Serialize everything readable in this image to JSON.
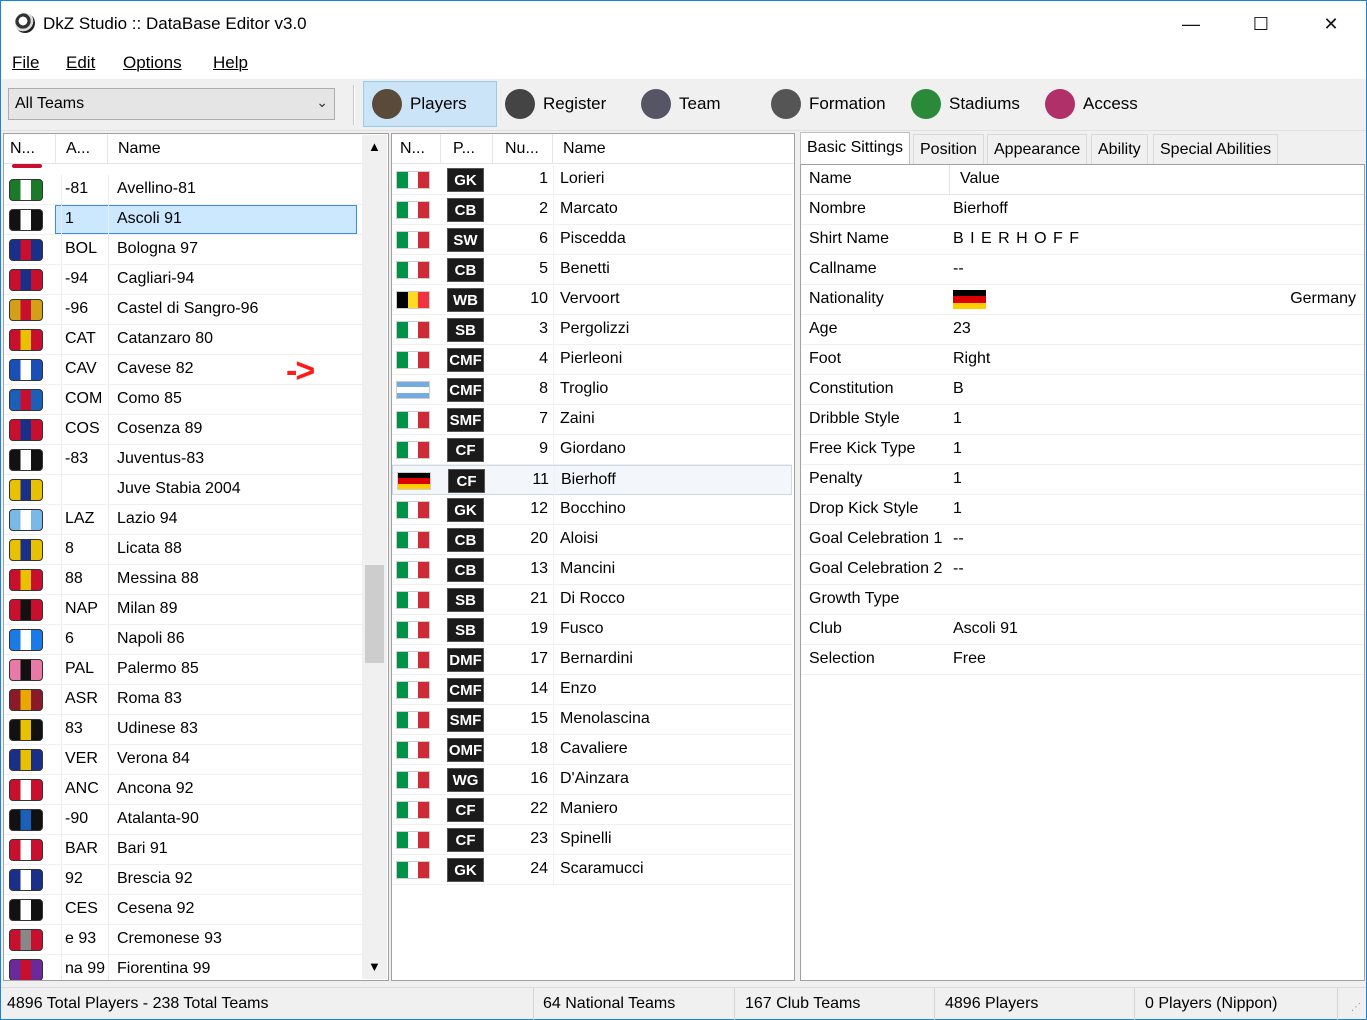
{
  "window": {
    "title": "DkZ Studio :: DataBase Editor v3.0",
    "minimize": "—",
    "maximize": "☐",
    "close": "✕"
  },
  "menu": [
    "File",
    "Edit",
    "Options",
    "Help"
  ],
  "toolbar": {
    "team_filter": "All Teams",
    "buttons": [
      {
        "label": "Players",
        "icon": "player-icon",
        "color": "#5a4a3a"
      },
      {
        "label": "Register",
        "icon": "register-icon",
        "color": "#444"
      },
      {
        "label": "Team",
        "icon": "team-icon",
        "color": "#556"
      },
      {
        "label": "Formation",
        "icon": "formation-icon",
        "color": "#555"
      },
      {
        "label": "Stadiums",
        "icon": "stadium-icon",
        "color": "#2a8a3a"
      },
      {
        "label": "Access",
        "icon": "access-icon",
        "color": "#b0306a"
      }
    ]
  },
  "teams_table": {
    "columns": [
      "N...",
      "A...",
      "Name"
    ],
    "selected_index": 1,
    "rows": [
      {
        "abbr": "-81",
        "name": "Avellino-81",
        "c1": "#1a7a2a",
        "c2": "#ffffff"
      },
      {
        "abbr": "1",
        "name": "Ascoli 91",
        "c1": "#111111",
        "c2": "#ffffff"
      },
      {
        "abbr": "BOL",
        "name": "Bologna 97",
        "c1": "#1a2f8a",
        "c2": "#c8102e"
      },
      {
        "abbr": "-94",
        "name": "Cagliari-94",
        "c1": "#c8102e",
        "c2": "#1a2f8a"
      },
      {
        "abbr": "-96",
        "name": "Castel di Sangro-96",
        "c1": "#d4a017",
        "c2": "#c8102e"
      },
      {
        "abbr": "CAT",
        "name": "Catanzaro 80",
        "c1": "#c8102e",
        "c2": "#e8c100"
      },
      {
        "abbr": "CAV",
        "name": "Cavese 82",
        "c1": "#1a4fb8",
        "c2": "#ffffff"
      },
      {
        "abbr": "COM",
        "name": "Como 85",
        "c1": "#1a5fb8",
        "c2": "#c8102e"
      },
      {
        "abbr": "COS",
        "name": "Cosenza 89",
        "c1": "#c8102e",
        "c2": "#1a2f8a"
      },
      {
        "abbr": "-83",
        "name": "Juventus-83",
        "c1": "#111111",
        "c2": "#ffffff"
      },
      {
        "abbr": "",
        "name": "Juve Stabia 2004",
        "c1": "#e8c100",
        "c2": "#1a2f8a"
      },
      {
        "abbr": "LAZ",
        "name": "Lazio 94",
        "c1": "#7ab8e8",
        "c2": "#ffffff"
      },
      {
        "abbr": "8",
        "name": "Licata 88",
        "c1": "#e8c100",
        "c2": "#1a2f8a"
      },
      {
        "abbr": "88",
        "name": "Messina 88",
        "c1": "#c8102e",
        "c2": "#e8c100"
      },
      {
        "abbr": "NAP",
        "name": "Milan 89",
        "c1": "#c8102e",
        "c2": "#111111"
      },
      {
        "abbr": "6",
        "name": "Napoli 86",
        "c1": "#1a7ae8",
        "c2": "#ffffff"
      },
      {
        "abbr": "PAL",
        "name": "Palermo 85",
        "c1": "#e87aa8",
        "c2": "#111111"
      },
      {
        "abbr": "ASR",
        "name": "Roma 83",
        "c1": "#8a1a2a",
        "c2": "#e8a800"
      },
      {
        "abbr": "83",
        "name": "Udinese 83",
        "c1": "#111111",
        "c2": "#e8c100"
      },
      {
        "abbr": "VER",
        "name": "Verona 84",
        "c1": "#1a2f8a",
        "c2": "#e8c100"
      },
      {
        "abbr": "ANC",
        "name": "Ancona 92",
        "c1": "#c8102e",
        "c2": "#ffffff"
      },
      {
        "abbr": "-90",
        "name": "Atalanta-90",
        "c1": "#111111",
        "c2": "#1a5fb8"
      },
      {
        "abbr": "BAR",
        "name": "Bari 91",
        "c1": "#c8102e",
        "c2": "#ffffff"
      },
      {
        "abbr": "92",
        "name": "Brescia 92",
        "c1": "#1a2f8a",
        "c2": "#ffffff"
      },
      {
        "abbr": "CES",
        "name": "Cesena 92",
        "c1": "#111111",
        "c2": "#ffffff"
      },
      {
        "abbr": "e 93",
        "name": "Cremonese 93",
        "c1": "#c8102e",
        "c2": "#888888"
      },
      {
        "abbr": "na 99",
        "name": "Fiorentina 99",
        "c1": "#6a2a9a",
        "c2": "#c8102e"
      }
    ]
  },
  "arrow_annotation": "->",
  "players_table": {
    "columns": [
      "N...",
      "P...",
      "Nu...",
      "Name"
    ],
    "selected_index": 10,
    "rows": [
      {
        "flag": "ita",
        "pos": "GK",
        "num": "1",
        "name": "Lorieri"
      },
      {
        "flag": "ita",
        "pos": "CB",
        "num": "2",
        "name": "Marcato"
      },
      {
        "flag": "ita",
        "pos": "SW",
        "num": "6",
        "name": "Piscedda"
      },
      {
        "flag": "ita",
        "pos": "CB",
        "num": "5",
        "name": "Benetti"
      },
      {
        "flag": "bel",
        "pos": "WB",
        "num": "10",
        "name": "Vervoort"
      },
      {
        "flag": "ita",
        "pos": "SB",
        "num": "3",
        "name": "Pergolizzi"
      },
      {
        "flag": "ita",
        "pos": "CMF",
        "num": "4",
        "name": "Pierleoni"
      },
      {
        "flag": "arg",
        "pos": "CMF",
        "num": "8",
        "name": "Troglio"
      },
      {
        "flag": "ita",
        "pos": "SMF",
        "num": "7",
        "name": "Zaini"
      },
      {
        "flag": "ita",
        "pos": "CF",
        "num": "9",
        "name": "Giordano"
      },
      {
        "flag": "ger",
        "pos": "CF",
        "num": "11",
        "name": "Bierhoff"
      },
      {
        "flag": "ita",
        "pos": "GK",
        "num": "12",
        "name": "Bocchino"
      },
      {
        "flag": "ita",
        "pos": "CB",
        "num": "20",
        "name": "Aloisi"
      },
      {
        "flag": "ita",
        "pos": "CB",
        "num": "13",
        "name": "Mancini"
      },
      {
        "flag": "ita",
        "pos": "SB",
        "num": "21",
        "name": "Di Rocco"
      },
      {
        "flag": "ita",
        "pos": "SB",
        "num": "19",
        "name": "Fusco"
      },
      {
        "flag": "ita",
        "pos": "DMF",
        "num": "17",
        "name": "Bernardini"
      },
      {
        "flag": "ita",
        "pos": "CMF",
        "num": "14",
        "name": "Enzo"
      },
      {
        "flag": "ita",
        "pos": "SMF",
        "num": "15",
        "name": "Menolascina"
      },
      {
        "flag": "ita",
        "pos": "OMF",
        "num": "18",
        "name": "Cavaliere"
      },
      {
        "flag": "ita",
        "pos": "WG",
        "num": "16",
        "name": "D'Ainzara"
      },
      {
        "flag": "ita",
        "pos": "CF",
        "num": "22",
        "name": "Maniero"
      },
      {
        "flag": "ita",
        "pos": "CF",
        "num": "23",
        "name": "Spinelli"
      },
      {
        "flag": "ita",
        "pos": "GK",
        "num": "24",
        "name": "Scaramucci"
      }
    ]
  },
  "detail_tabs": [
    "Basic Sittings",
    "Position",
    "Appearance",
    "Ability",
    "Special Abilities"
  ],
  "details": {
    "columns": [
      "Name",
      "Value"
    ],
    "rows": [
      {
        "key": "Nombre",
        "value": "Bierhoff"
      },
      {
        "key": "Shirt Name",
        "value": "B I E R H O F F"
      },
      {
        "key": "Callname",
        "value": "--"
      },
      {
        "key": "Nationality",
        "value": "Germany",
        "flag": "ger"
      },
      {
        "key": "Age",
        "value": "23"
      },
      {
        "key": "Foot",
        "value": "Right"
      },
      {
        "key": "Constitution",
        "value": "B"
      },
      {
        "key": "Dribble Style",
        "value": "1"
      },
      {
        "key": "Free Kick Type",
        "value": "1"
      },
      {
        "key": "Penalty",
        "value": "1"
      },
      {
        "key": "Drop Kick Style",
        "value": "1"
      },
      {
        "key": "Goal Celebration 1",
        "value": "--"
      },
      {
        "key": "Goal Celebration 2",
        "value": "--"
      },
      {
        "key": "Growth Type",
        "value": ""
      },
      {
        "key": "Club",
        "value": "Ascoli 91"
      },
      {
        "key": "Selection",
        "value": "Free"
      }
    ]
  },
  "status": {
    "total": "4896 Total Players  -  238 Total Teams",
    "national": "64 National Teams",
    "club": "167 Club Teams",
    "players": "4896 Players",
    "nippon": "0 Players (Nippon)"
  },
  "flags": {
    "ita": [
      "#009246",
      "#ffffff",
      "#ce2b37"
    ],
    "bel": [
      "#000000",
      "#fdda24",
      "#ef3340"
    ],
    "ger": [
      "#000000",
      "#dd0000",
      "#ffce00"
    ],
    "arg": [
      "#74acdf",
      "#ffffff",
      "#74acdf"
    ]
  }
}
